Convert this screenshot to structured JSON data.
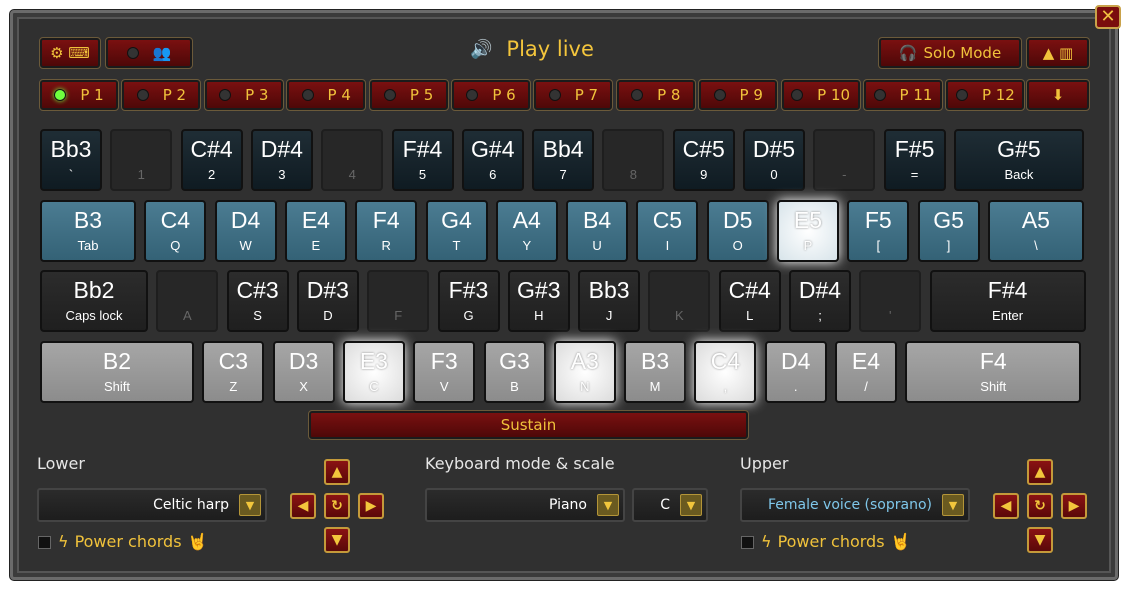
{
  "header": {
    "settings_icons": "⚙ ⌨",
    "title": "Play live",
    "solo_label": "Solo Mode",
    "collapse_icons": "▲ ▥"
  },
  "presets": [
    "P 1",
    "P 2",
    "P 3",
    "P 4",
    "P 5",
    "P 6",
    "P 7",
    "P 8",
    "P 9",
    "P 10",
    "P 11",
    "P 12"
  ],
  "active_preset": "P 1",
  "keys": {
    "row1": [
      [
        "Bb3",
        "`"
      ],
      [
        "",
        "1"
      ],
      [
        "C#4",
        "2"
      ],
      [
        "D#4",
        "3"
      ],
      [
        "",
        "4"
      ],
      [
        "F#4",
        "5"
      ],
      [
        "G#4",
        "6"
      ],
      [
        "Bb4",
        "7"
      ],
      [
        "",
        "8"
      ],
      [
        "C#5",
        "9"
      ],
      [
        "D#5",
        "0"
      ],
      [
        "",
        "-"
      ],
      [
        "F#5",
        "="
      ],
      [
        "G#5",
        "Back"
      ]
    ],
    "row2": [
      [
        "B3",
        "Tab"
      ],
      [
        "C4",
        "Q"
      ],
      [
        "D4",
        "W"
      ],
      [
        "E4",
        "E"
      ],
      [
        "F4",
        "R"
      ],
      [
        "G4",
        "T"
      ],
      [
        "A4",
        "Y"
      ],
      [
        "B4",
        "U"
      ],
      [
        "C5",
        "I"
      ],
      [
        "D5",
        "O"
      ],
      [
        "E5",
        "P"
      ],
      [
        "F5",
        "["
      ],
      [
        "G5",
        "]"
      ],
      [
        "A5",
        "\\"
      ]
    ],
    "row3": [
      [
        "Bb2",
        "Caps lock"
      ],
      [
        "",
        "A"
      ],
      [
        "C#3",
        "S"
      ],
      [
        "D#3",
        "D"
      ],
      [
        "",
        "F"
      ],
      [
        "F#3",
        "G"
      ],
      [
        "G#3",
        "H"
      ],
      [
        "Bb3",
        "J"
      ],
      [
        "",
        "K"
      ],
      [
        "C#4",
        "L"
      ],
      [
        "D#4",
        ";"
      ],
      [
        "",
        "'"
      ],
      [
        "F#4",
        "Enter"
      ]
    ],
    "row4": [
      [
        "B2",
        "Shift"
      ],
      [
        "C3",
        "Z"
      ],
      [
        "D3",
        "X"
      ],
      [
        "E3",
        "C"
      ],
      [
        "F3",
        "V"
      ],
      [
        "G3",
        "B"
      ],
      [
        "A3",
        "N"
      ],
      [
        "B3",
        "M"
      ],
      [
        "C4",
        ","
      ],
      [
        "D4",
        "."
      ],
      [
        "E4",
        "/"
      ],
      [
        "F4",
        "Shift"
      ]
    ]
  },
  "sustain_label": "Sustain",
  "lower": {
    "label": "Lower",
    "instrument": "Celtic harp",
    "power_chords": "Power chords"
  },
  "mode": {
    "label": "Keyboard mode & scale",
    "mode": "Piano",
    "scale": "C"
  },
  "upper": {
    "label": "Upper",
    "instrument": "Female voice (soprano)",
    "power_chords": "Power chords"
  },
  "colors": {
    "accent": "#f3c53c",
    "button_red": "#6a0c0c",
    "blue_key": "#3f6f85",
    "led_on": "#6fff3f"
  }
}
